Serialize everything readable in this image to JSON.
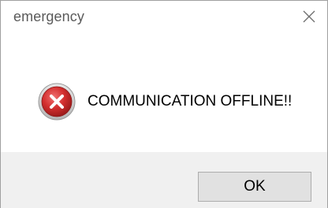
{
  "window": {
    "title": "emergency",
    "close_icon": "close-icon"
  },
  "message": {
    "icon": "error-icon",
    "text": "COMMUNICATION OFFLINE!!"
  },
  "buttons": {
    "ok_label": "OK"
  },
  "colors": {
    "error_red": "#c62828",
    "footer_bg": "#f0f0f0",
    "button_bg": "#e1e1e1"
  }
}
